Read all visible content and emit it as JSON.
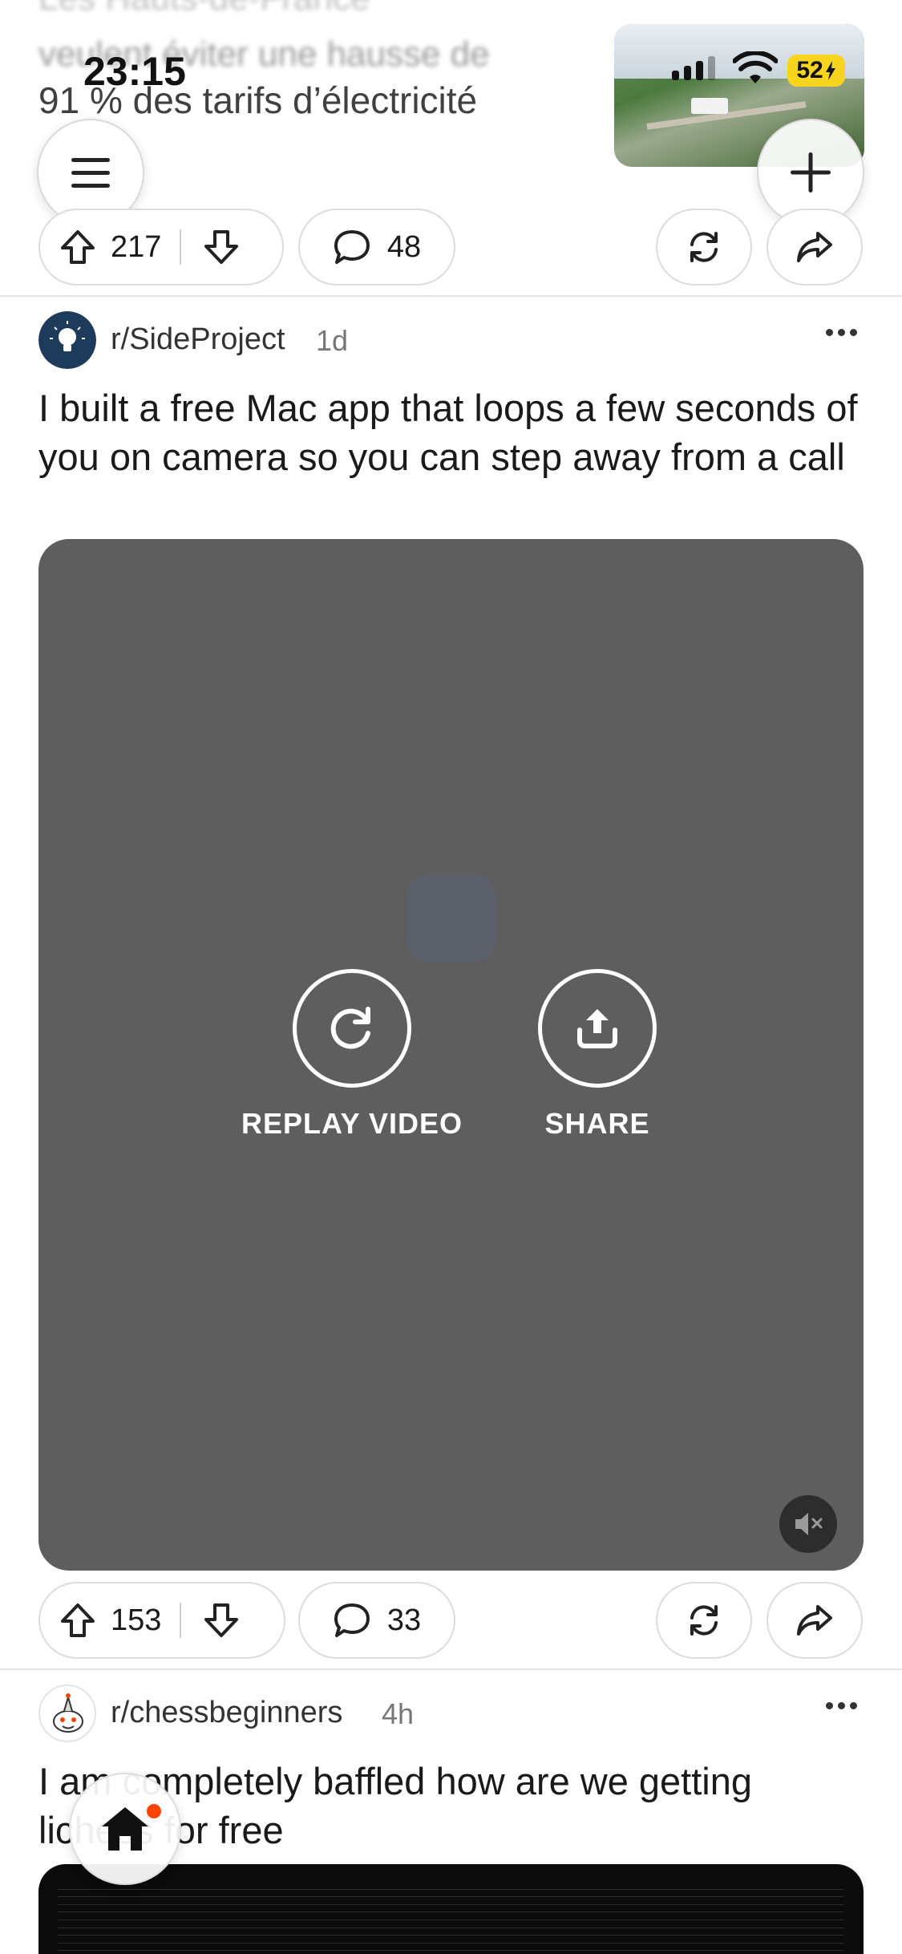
{
  "status_bar": {
    "time": "23:15",
    "battery": "52"
  },
  "previous_post": {
    "title_line_1": "Les Hauts-de-France",
    "title_line_2": "veulent éviter une hausse de",
    "title_line_3": "91 % des tarifs d’électricité",
    "upvotes": "217",
    "comments": "48"
  },
  "post": {
    "subreddit": "r/SideProject",
    "age": "1d",
    "title": "I built a free Mac app that loops a few seconds of you on camera so you can step away from a call",
    "video": {
      "replay_label": "REPLAY VIDEO",
      "share_label": "SHARE"
    },
    "upvotes": "153",
    "comments": "33"
  },
  "next_post": {
    "subreddit": "r/chessbeginners",
    "age": "4h",
    "title": "I am completely baffled how are we getting lichess for free"
  },
  "icons": {
    "menu": "hamburger-icon",
    "add": "plus-icon",
    "upvote": "arrow-up-icon",
    "downvote": "arrow-down-icon",
    "comment": "speech-bubble-icon",
    "repost": "repost-icon",
    "share": "share-arrow-icon",
    "replay": "replay-icon",
    "upload": "upload-icon",
    "mute": "muted-speaker-icon",
    "home": "home-icon"
  },
  "colors": {
    "accent": "#ff4500",
    "battery": "#f7d51e",
    "video_bg": "#5e5e5e"
  }
}
